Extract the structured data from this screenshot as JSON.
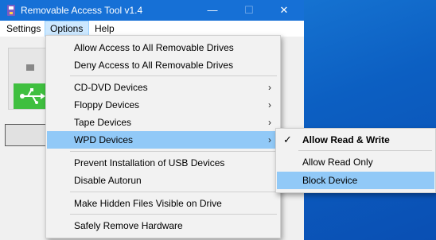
{
  "window": {
    "title": "Removable Access Tool v1.4",
    "controls": {
      "minimize": "—",
      "maximize": "☐",
      "close": "✕"
    }
  },
  "menubar": {
    "items": [
      {
        "label": "Settings"
      },
      {
        "label": "Options",
        "active": true
      },
      {
        "label": "Help"
      }
    ]
  },
  "options_menu": {
    "items": [
      {
        "label": "Allow Access to All Removable Drives"
      },
      {
        "label": "Deny Access to All Removable Drives"
      },
      {
        "label": "CD-DVD Devices",
        "submenu_arrow": "›"
      },
      {
        "label": "Floppy Devices",
        "submenu_arrow": "›"
      },
      {
        "label": "Tape Devices",
        "submenu_arrow": "›"
      },
      {
        "label": "WPD Devices",
        "submenu_arrow": "›",
        "highlighted": true
      },
      {
        "label": "Prevent Installation of USB Devices"
      },
      {
        "label": "Disable Autorun"
      },
      {
        "label": "Make Hidden Files Visible on Drive"
      },
      {
        "label": "Safely Remove Hardware"
      }
    ]
  },
  "wpd_submenu": {
    "items": [
      {
        "label": "Allow Read & Write",
        "checked": true,
        "check_glyph": "✓"
      },
      {
        "label": "Allow Read Only"
      },
      {
        "label": "Block Device",
        "highlighted": true
      }
    ]
  },
  "colors": {
    "titlebar": "#1670d6",
    "highlight": "#91c9f7",
    "device_green": "#3fbf3f",
    "desktop": "#0a63c9"
  }
}
